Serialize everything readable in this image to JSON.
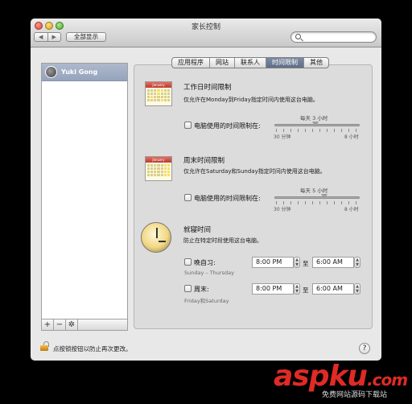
{
  "window": {
    "title": "家长控制",
    "show_all": "全部显示"
  },
  "nav": {
    "back": "◀",
    "forward": "▶"
  },
  "search": {
    "placeholder": ""
  },
  "users": [
    {
      "name": "Yuki Gong"
    }
  ],
  "list_tools": {
    "add": "+",
    "remove": "−",
    "gear": "✲"
  },
  "tabs": [
    {
      "label": "应用程序",
      "active": false
    },
    {
      "label": "网站",
      "active": false
    },
    {
      "label": "联系人",
      "active": false
    },
    {
      "label": "时间限制",
      "active": true
    },
    {
      "label": "其他",
      "active": false
    }
  ],
  "weekday": {
    "title": "工作日时间限制",
    "desc": "仅允许在Monday到Friday指定时间内使用这台电脑。",
    "calendar_month": "January",
    "checkbox_label": "电脑使用的时间限制在:",
    "checked": false,
    "slider_value_label": "每天 3 小时",
    "slider_min_label": "30 分钟",
    "slider_max_label": "8 小时",
    "hours": 3
  },
  "weekend": {
    "title": "周末时间限制",
    "desc": "仅允许在Saturday和Sunday指定时间内使用这台电脑。",
    "calendar_month": "January",
    "checkbox_label": "电脑使用的时间限制在:",
    "checked": false,
    "slider_value_label": "每天 5 小时",
    "slider_min_label": "30 分钟",
    "slider_max_label": "8 小时",
    "hours": 5
  },
  "bedtime": {
    "title": "就寝时间",
    "desc": "防止在特定时段使用这台电脑。",
    "school_nights": {
      "label": "晚自习:",
      "days": "Sunday – Thursday",
      "from": "8:00 PM",
      "to_label": "至",
      "to": "6:00 AM",
      "checked": false
    },
    "weekend": {
      "label": "周末:",
      "days": "Friday和Saturday",
      "from": "8:00 PM",
      "to_label": "至",
      "to": "6:00 AM",
      "checked": false
    }
  },
  "footer": {
    "lock_text": "点按锁按钮以防止再次更改。",
    "help": "?"
  },
  "watermark": {
    "brand": "aspku",
    "suffix": ".com",
    "sub": "免费网站源码下载站"
  }
}
